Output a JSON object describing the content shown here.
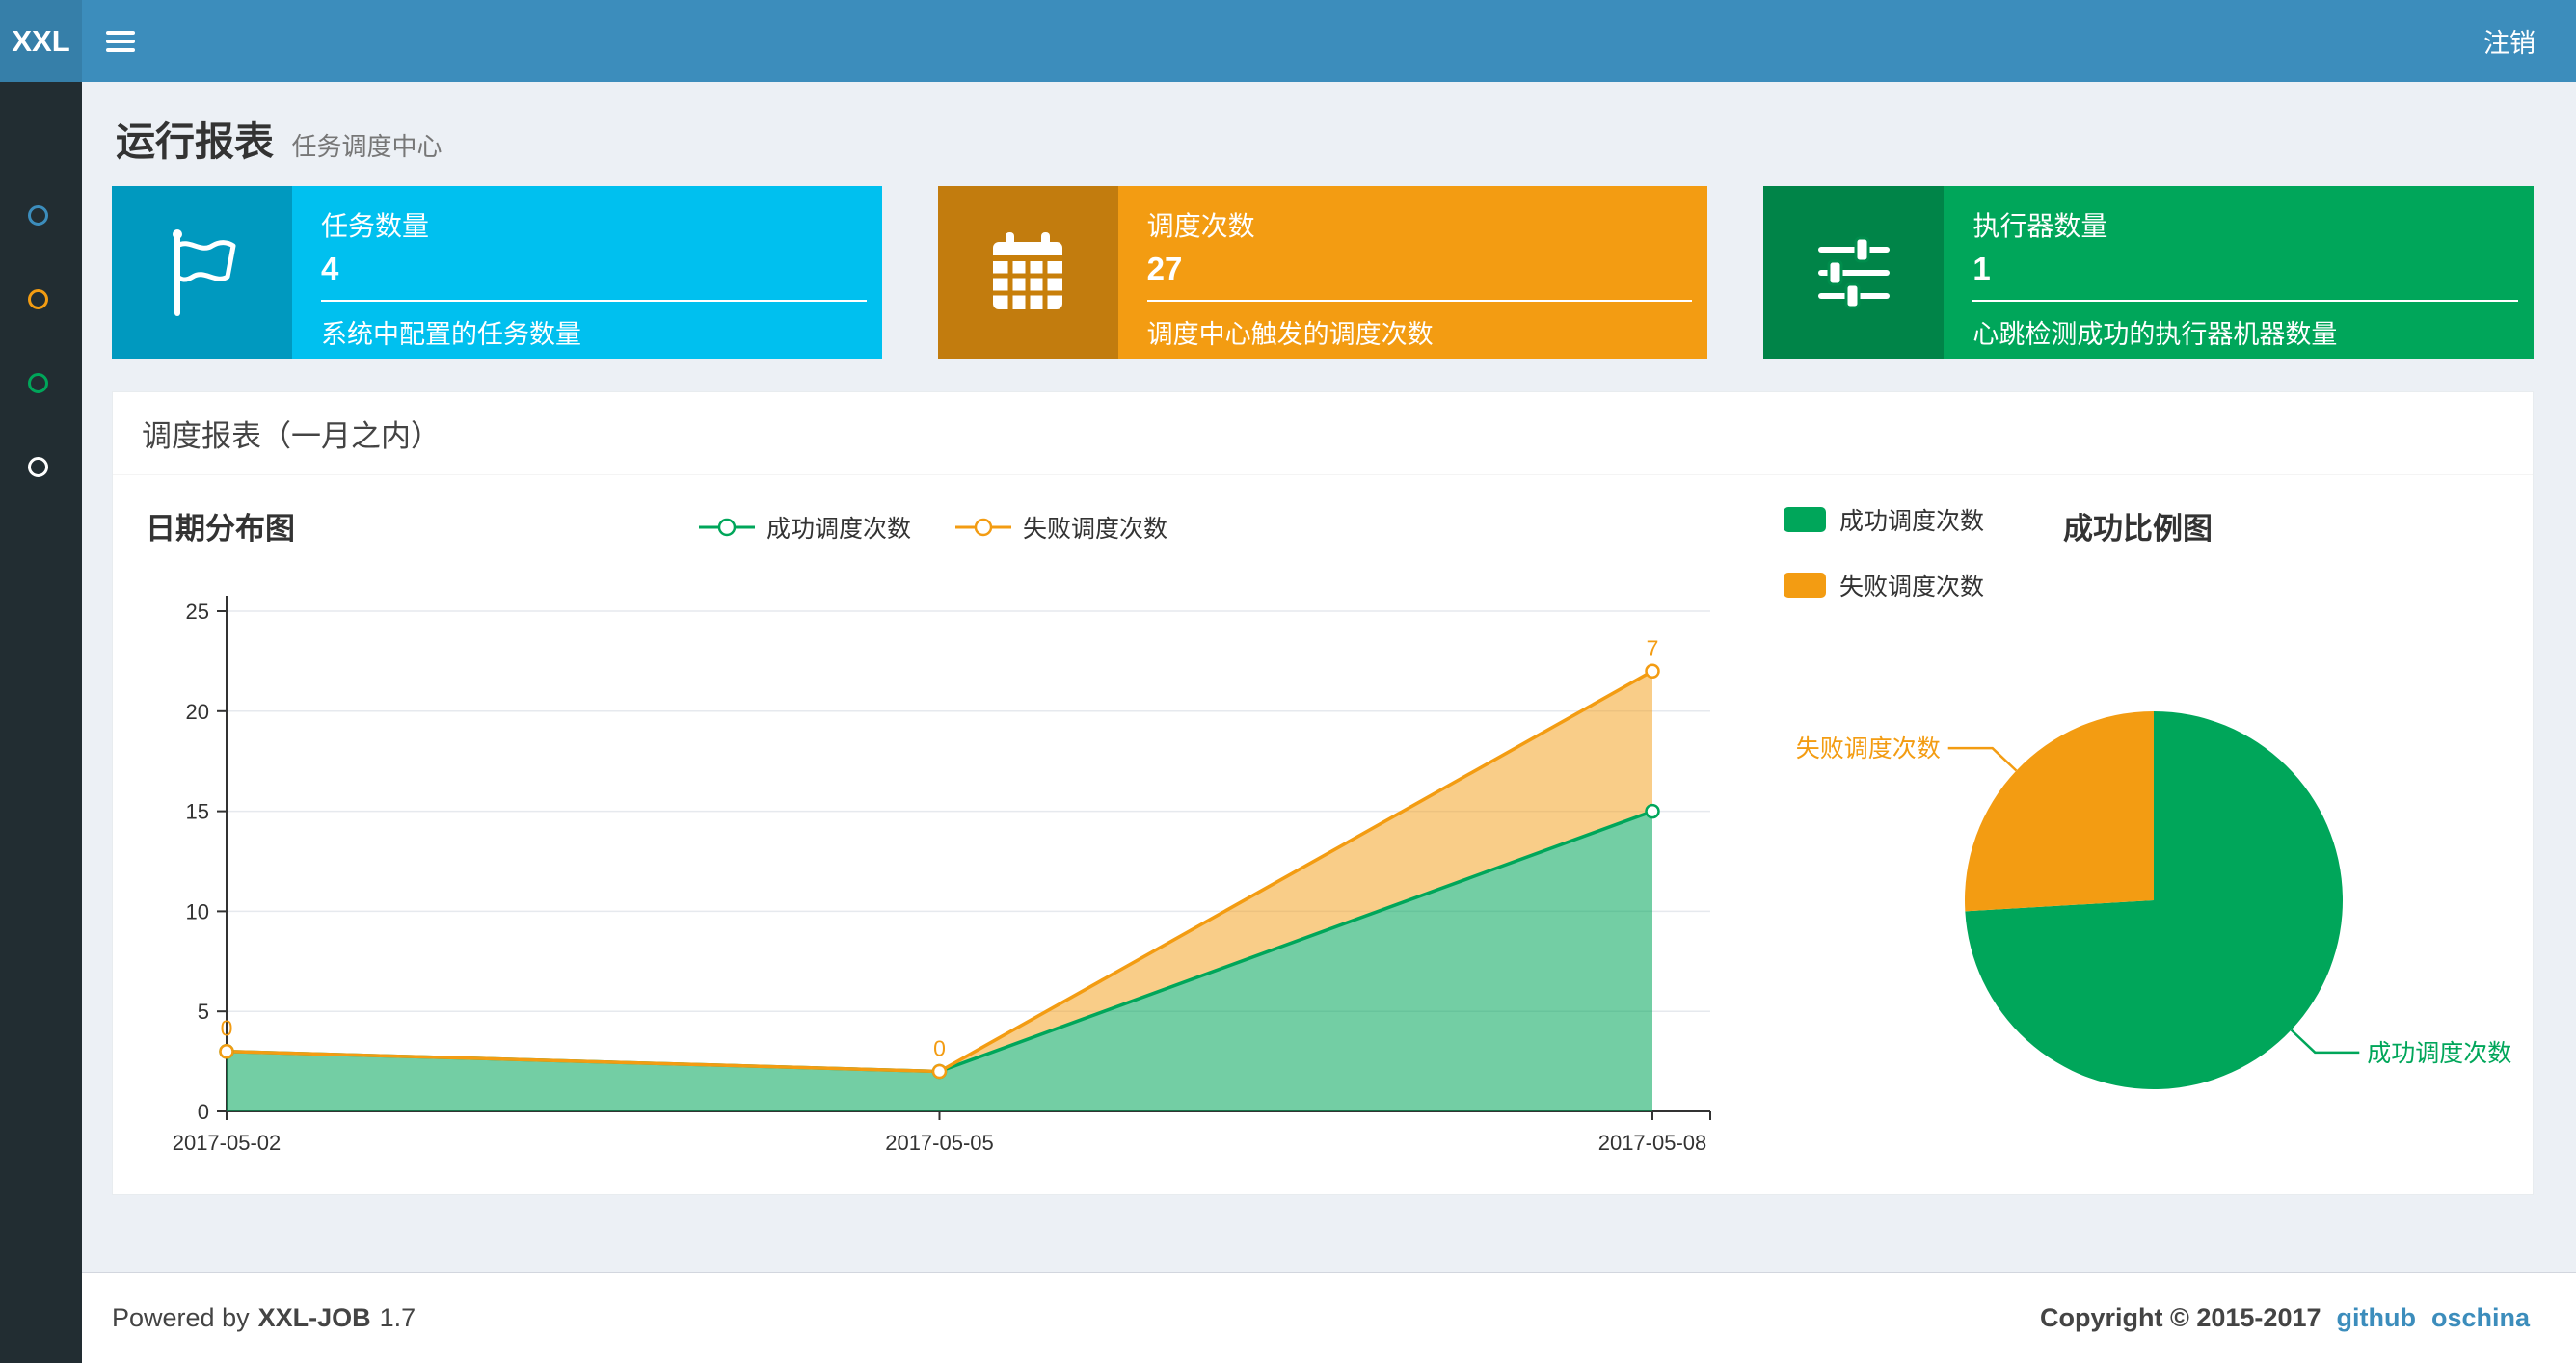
{
  "header": {
    "logo": "XXL",
    "logout_label": "注销"
  },
  "sidebar": {
    "items": [
      {
        "icon": "circle-icon",
        "color": "#3c8dbc"
      },
      {
        "icon": "circle-icon",
        "color": "#f39c12"
      },
      {
        "icon": "circle-icon",
        "color": "#00a65a"
      },
      {
        "icon": "circle-icon",
        "color": "#ffffff"
      }
    ]
  },
  "page": {
    "title": "运行报表",
    "subtitle": "任务调度中心"
  },
  "info_boxes": [
    {
      "icon": "flag-icon",
      "title": "任务数量",
      "value": "4",
      "desc": "系统中配置的任务数量",
      "color": "#00c0ef"
    },
    {
      "icon": "calendar-icon",
      "title": "调度次数",
      "value": "27",
      "desc": "调度中心触发的调度次数",
      "color": "#f39c12"
    },
    {
      "icon": "sliders-icon",
      "title": "执行器数量",
      "value": "1",
      "desc": "心跳检测成功的执行器机器数量",
      "color": "#00a65a"
    }
  ],
  "panel": {
    "title": "调度报表（一月之内）"
  },
  "chart_data": [
    {
      "type": "area",
      "title": "日期分布图",
      "stacked": true,
      "categories": [
        "2017-05-02",
        "2017-05-05",
        "2017-05-08"
      ],
      "ylim": [
        0,
        25
      ],
      "yticks": [
        0,
        5,
        10,
        15,
        20,
        25
      ],
      "grid": true,
      "legend_position": "top-center",
      "series": [
        {
          "name": "成功调度次数",
          "color": "#00a65a",
          "values": [
            3,
            2,
            15
          ]
        },
        {
          "name": "失败调度次数",
          "color": "#f39c12",
          "values": [
            0,
            0,
            7
          ],
          "point_labels": [
            "0",
            "0",
            "7"
          ]
        }
      ]
    },
    {
      "type": "pie",
      "title": "成功比例图",
      "legend_position": "top-left",
      "total": 27,
      "slices": [
        {
          "name": "成功调度次数",
          "value": 20,
          "color": "#00a65a"
        },
        {
          "name": "失败调度次数",
          "value": 7,
          "color": "#f39c12"
        }
      ]
    }
  ],
  "footer": {
    "powered_prefix": "Powered by",
    "product": "XXL-JOB",
    "version": "1.7",
    "copyright": "Copyright © 2015-2017",
    "links": [
      "github",
      "oschina"
    ]
  }
}
